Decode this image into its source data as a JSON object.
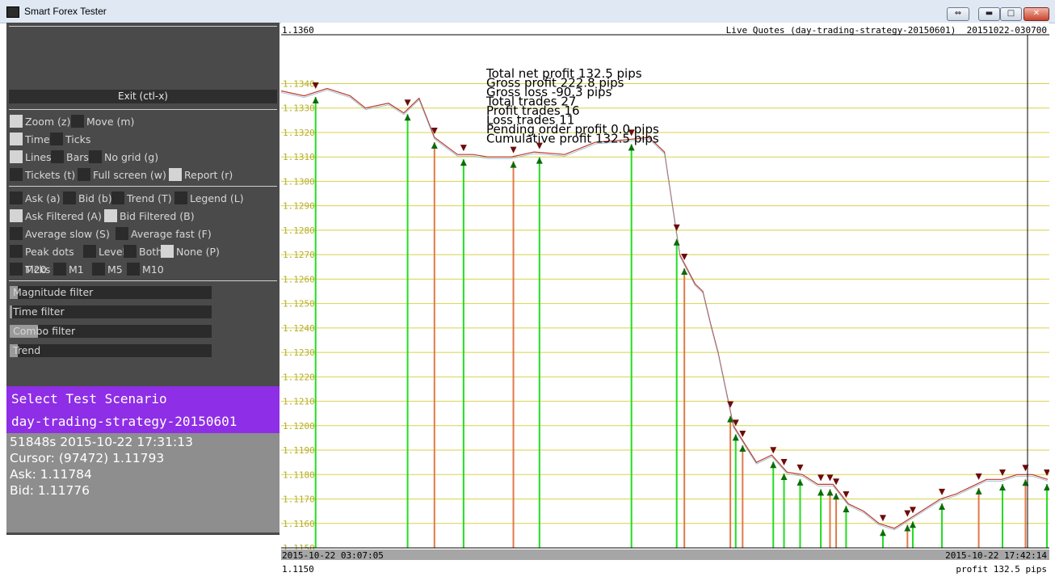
{
  "window": {
    "title": "Smart Forex Tester"
  },
  "left_panel": {
    "exit_label": "Exit (ctl-x)",
    "rows": [
      [
        {
          "label": "Zoom (z)",
          "on": true
        },
        {
          "label": "Move (m)",
          "on": false
        }
      ],
      [
        {
          "label": "Time",
          "on": true
        },
        {
          "label": "Ticks",
          "on": false
        }
      ],
      [
        {
          "label": "Lines",
          "on": true
        },
        {
          "label": "Bars",
          "on": false
        },
        {
          "label": "No grid (g)",
          "on": false
        }
      ],
      [
        {
          "label": "Tickets (t)",
          "on": false
        },
        {
          "label": "Full screen (w)",
          "on": false
        },
        {
          "label": "Report (r)",
          "on": true
        }
      ],
      [
        {
          "label": "Ask (a)",
          "on": false
        },
        {
          "label": "Bid (b)",
          "on": false
        },
        {
          "label": "Trend (T)",
          "on": false
        },
        {
          "label": "Legend (L)",
          "on": false
        }
      ],
      [
        {
          "label": "Ask Filtered (A)",
          "on": true
        },
        {
          "label": "Bid Filtered (B)",
          "on": true
        }
      ],
      [
        {
          "label": "Average slow (S)",
          "on": false
        },
        {
          "label": "Average fast (F)",
          "on": false
        }
      ],
      [
        {
          "label": "Peak dots",
          "on": false
        },
        {
          "label": "Levels",
          "on": false
        },
        {
          "label": "Both",
          "on": false
        },
        {
          "label": "None (P)",
          "on": true
        }
      ],
      [
        {
          "label": "Ticks",
          "on": true
        },
        {
          "label": "M1",
          "on": false
        },
        {
          "label": "M5",
          "on": false
        },
        {
          "label": "M10",
          "on": false
        },
        {
          "label": "M20",
          "on": false
        }
      ]
    ],
    "sliders": [
      {
        "label": "Magnitude filter",
        "level": 0.04
      },
      {
        "label": "Time filter",
        "level": 0.01
      },
      {
        "label": "Combo filter",
        "level": 0.14
      },
      {
        "label": "Trend",
        "level": 0.04
      }
    ],
    "scenario_header": "Select Test Scenario",
    "scenario_name": "day-trading-strategy-20150601",
    "info_lines": [
      "51848s  2015-10-22  17:31:13",
      "Cursor:  (97472)  1.11793",
      "Ask:  1.11784",
      "Bid:  1.11776"
    ]
  },
  "chart": {
    "top_left_label": "1.1360",
    "top_right_label": "Live Quotes (day-trading-strategy-20150601) _20151022-030700",
    "bottom_left_label": "1.1150",
    "bottom_right_label": "profit 132.5 pips",
    "x_start_label": "2015-10-22 03:07:05",
    "x_end_label": "2015-10-22 17:42:14",
    "stats": [
      "Total net profit 132.5 pips",
      "Gross profit 222.8 pips",
      "Gross loss -90.3 pips",
      "Total trades 27",
      "Profit trades 16",
      "Loss trades 11",
      "Pending order profit 0.0 pips",
      "Cumulative profit 132.5 pips"
    ]
  },
  "colors": {
    "grid_line": "#d8d24a",
    "price_line": "#c0392b",
    "buy_marker": "#0a6b0a",
    "sell_marker": "#6e0b0b",
    "profit_line": "#22dd22",
    "loss_line": "#e07a4a",
    "accent_purple": "#8e2ee6"
  },
  "chart_data": {
    "type": "line",
    "ylim": [
      1.115,
      1.136
    ],
    "y_ticks": [
      "1.1340",
      "1.1330",
      "1.1320",
      "1.1310",
      "1.1300",
      "1.1290",
      "1.1280",
      "1.1270",
      "1.1260",
      "1.1250",
      "1.1240",
      "1.1230",
      "1.1220",
      "1.1210",
      "1.1200",
      "1.1190",
      "1.1180",
      "1.1170",
      "1.1160",
      "1.1150"
    ],
    "price_x": [
      0,
      0.03,
      0.06,
      0.09,
      0.11,
      0.14,
      0.16,
      0.18,
      0.2,
      0.23,
      0.25,
      0.27,
      0.3,
      0.33,
      0.37,
      0.41,
      0.45,
      0.48,
      0.5,
      0.52,
      0.54,
      0.55,
      0.56,
      0.57,
      0.58,
      0.59,
      0.6,
      0.62,
      0.64,
      0.66,
      0.68,
      0.7,
      0.72,
      0.74,
      0.76,
      0.78,
      0.8,
      0.82,
      0.84,
      0.86,
      0.88,
      0.9,
      0.92,
      0.94,
      0.96,
      0.98,
      1.0
    ],
    "price_y": [
      1.1337,
      1.1335,
      1.1338,
      1.1335,
      1.133,
      1.1332,
      1.1328,
      1.1334,
      1.1318,
      1.1311,
      1.1311,
      1.131,
      1.131,
      1.1312,
      1.1311,
      1.1316,
      1.1317,
      1.1318,
      1.1312,
      1.127,
      1.1258,
      1.1255,
      1.1242,
      1.123,
      1.1215,
      1.12,
      1.1195,
      1.1185,
      1.1188,
      1.1181,
      1.118,
      1.1176,
      1.1176,
      1.1168,
      1.1165,
      1.116,
      1.1158,
      1.1162,
      1.1166,
      1.117,
      1.1172,
      1.1175,
      1.1178,
      1.1178,
      1.118,
      1.118,
      1.1178
    ],
    "trades": [
      {
        "x": 0.045,
        "result": "profit"
      },
      {
        "x": 0.165,
        "result": "profit"
      },
      {
        "x": 0.2,
        "result": "loss"
      },
      {
        "x": 0.238,
        "result": "profit"
      },
      {
        "x": 0.303,
        "result": "loss"
      },
      {
        "x": 0.337,
        "result": "profit"
      },
      {
        "x": 0.457,
        "result": "profit"
      },
      {
        "x": 0.516,
        "result": "profit"
      },
      {
        "x": 0.526,
        "result": "loss"
      },
      {
        "x": 0.586,
        "result": "loss"
      },
      {
        "x": 0.593,
        "result": "profit"
      },
      {
        "x": 0.602,
        "result": "loss"
      },
      {
        "x": 0.642,
        "result": "profit"
      },
      {
        "x": 0.656,
        "result": "profit"
      },
      {
        "x": 0.677,
        "result": "profit"
      },
      {
        "x": 0.704,
        "result": "profit"
      },
      {
        "x": 0.716,
        "result": "loss"
      },
      {
        "x": 0.724,
        "result": "loss"
      },
      {
        "x": 0.737,
        "result": "profit"
      },
      {
        "x": 0.785,
        "result": "profit"
      },
      {
        "x": 0.817,
        "result": "loss"
      },
      {
        "x": 0.824,
        "result": "profit"
      },
      {
        "x": 0.862,
        "result": "profit"
      },
      {
        "x": 0.91,
        "result": "loss"
      },
      {
        "x": 0.941,
        "result": "profit"
      },
      {
        "x": 0.971,
        "result": "loss"
      },
      {
        "x": 0.999,
        "result": "profit"
      }
    ]
  }
}
